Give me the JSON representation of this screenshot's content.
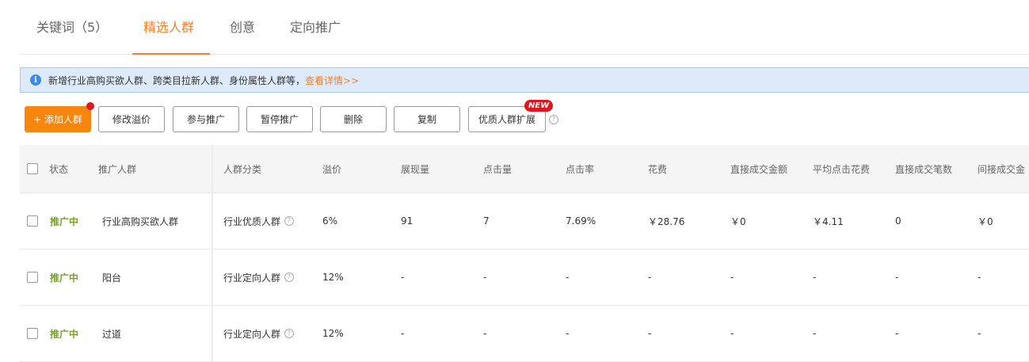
{
  "tabs": [
    {
      "label": "关键词（5）"
    },
    {
      "label": "精选人群"
    },
    {
      "label": "创意"
    },
    {
      "label": "定向推广"
    }
  ],
  "notice": {
    "text": "新增行业高购买欲人群、跨类目拉新人群、身份属性人群等，",
    "link": "查看详情>>"
  },
  "toolbar": {
    "add": "+ 添加人群",
    "modify_premium": "修改溢价",
    "join": "参与推广",
    "pause": "暂停推广",
    "delete": "删除",
    "copy": "复制",
    "expand": "优质人群扩展",
    "new_badge": "NEW"
  },
  "table": {
    "headers": {
      "status": "状态",
      "group": "推广人群",
      "category": "人群分类",
      "premium": "溢价",
      "impressions": "展现量",
      "clicks": "点击量",
      "ctr": "点击率",
      "cost": "花费",
      "direct_amount": "直接成交金额",
      "avg_cpc": "平均点击花费",
      "direct_count": "直接成交笔数",
      "indirect_amount": "间接成交金"
    },
    "rows": [
      {
        "status": "推广中",
        "group": "行业高购买欲人群",
        "category": "行业优质人群",
        "premium": "6%",
        "impressions": "91",
        "clicks": "7",
        "ctr": "7.69%",
        "cost": "￥28.76",
        "direct_amount": "￥0",
        "avg_cpc": "￥4.11",
        "direct_count": "0",
        "indirect_amount": "￥0"
      },
      {
        "status": "推广中",
        "group": "阳台",
        "category": "行业定向人群",
        "premium": "12%",
        "impressions": "-",
        "clicks": "-",
        "ctr": "-",
        "cost": "-",
        "direct_amount": "-",
        "avg_cpc": "-",
        "direct_count": "-",
        "indirect_amount": "-"
      },
      {
        "status": "推广中",
        "group": "过道",
        "category": "行业定向人群",
        "premium": "12%",
        "impressions": "-",
        "clicks": "-",
        "ctr": "-",
        "cost": "-",
        "direct_amount": "-",
        "avg_cpc": "-",
        "direct_count": "-",
        "indirect_amount": "-"
      }
    ]
  },
  "colors": {
    "accent": "#f2822f",
    "primary_button": "#f7860f",
    "status_active": "#78a12b",
    "badge_red": "#e0151d",
    "notice_bg": "#dceaf9"
  }
}
